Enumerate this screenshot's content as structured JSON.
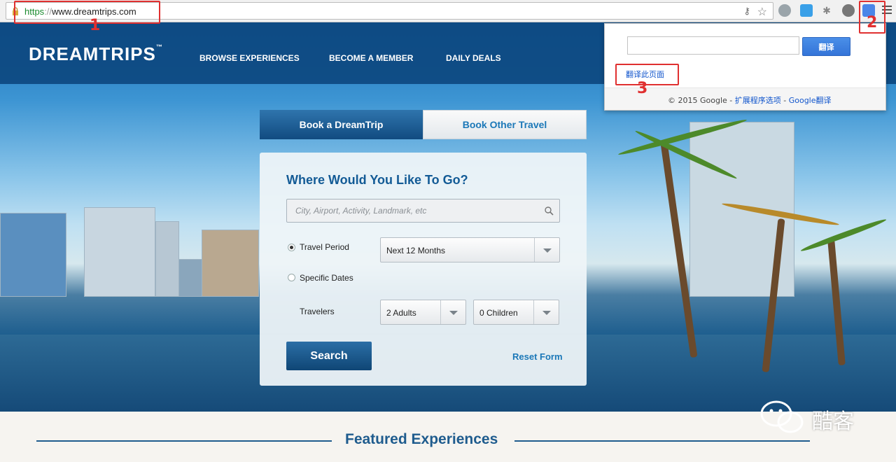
{
  "browser": {
    "url_protocol": "https",
    "url_separator": "://",
    "url_host": "www.dreamtrips.com"
  },
  "annotations": [
    "1",
    "2",
    "3"
  ],
  "site": {
    "logo": "DREAMTRIPS",
    "logo_tm": "™",
    "nav": [
      "BROWSE EXPERIENCES",
      "BECOME A MEMBER",
      "DAILY DEALS"
    ]
  },
  "booking": {
    "tab_active": "Book a DreamTrip",
    "tab_other": "Book Other Travel",
    "title": "Where Would You Like To Go?",
    "search_placeholder": "City, Airport, Activity, Landmark, etc",
    "travel_period_label": "Travel Period",
    "travel_period_value": "Next 12 Months",
    "specific_dates_label": "Specific Dates",
    "travelers_label": "Travelers",
    "adults_value": "2 Adults",
    "children_value": "0 Children",
    "search_button": "Search",
    "reset_link": "Reset Form"
  },
  "translate_popup": {
    "translate_button": "翻译",
    "translate_page_link": "翻译此页面",
    "footer_copyright": "© 2015 Google - ",
    "footer_options": "扩展程序选项",
    "footer_dash": " - ",
    "footer_gt": "Google翻译"
  },
  "featured": {
    "title": "Featured Experiences"
  },
  "watermark": "酷客"
}
